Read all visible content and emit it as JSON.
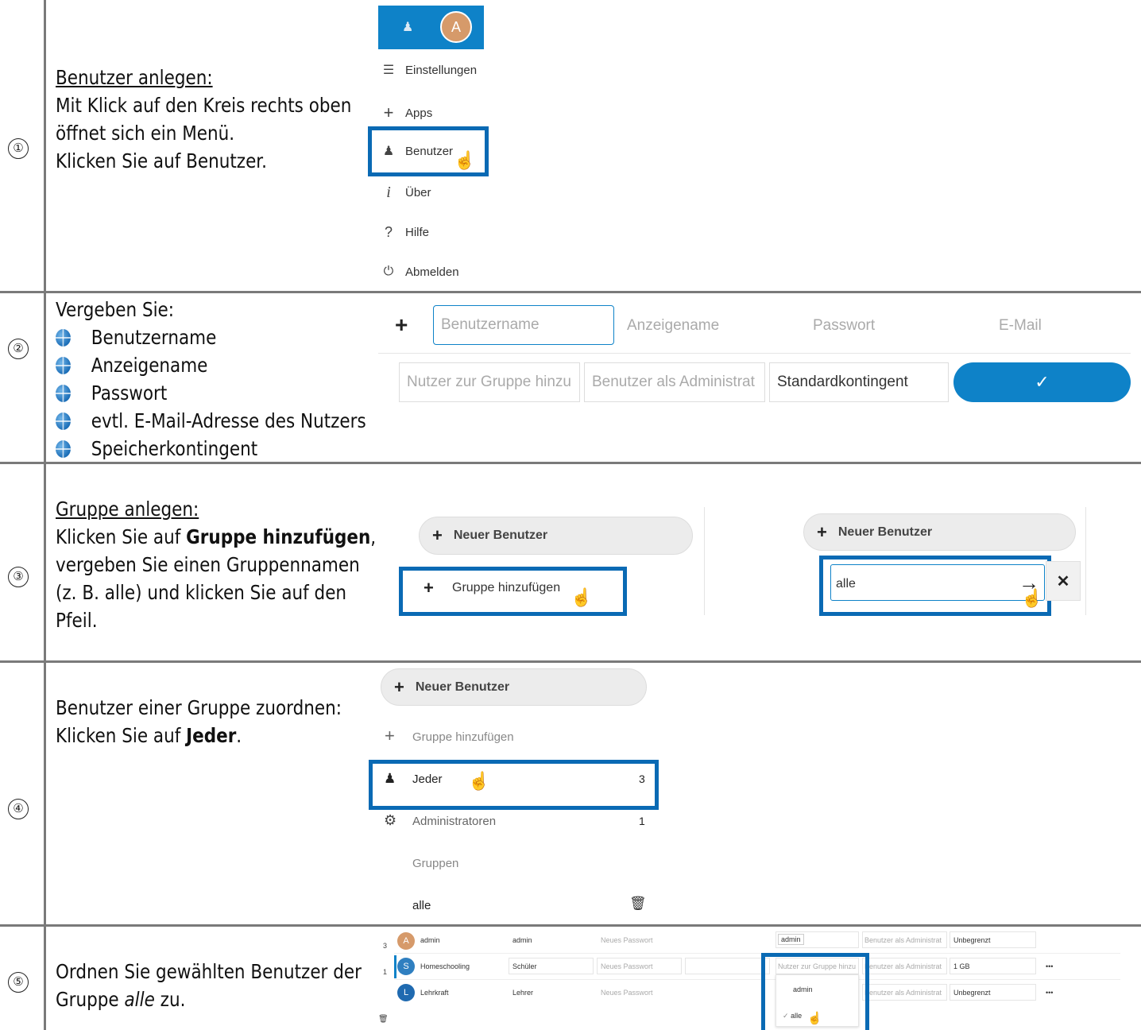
{
  "steps": [
    {
      "num": "①",
      "heading": "Benutzer anlegen:",
      "lines": [
        "Mit Klick auf den Kreis rechts oben",
        "öffnet sich ein Menü.",
        "Klicken Sie auf Benutzer."
      ]
    },
    {
      "num": "②",
      "intro": "Vergeben Sie:",
      "bullets": [
        "Benutzername",
        "Anzeigename",
        "Passwort",
        "evtl. E-Mail-Adresse des Nutzers",
        "Speicherkontingent"
      ]
    },
    {
      "num": "③",
      "heading": "Gruppe anlegen:",
      "l1_a": "Klicken Sie auf ",
      "l1_b": "Gruppe hinzufügen",
      "l1_c": ",",
      "l2": "vergeben Sie einen Gruppennamen",
      "l3": "(z. B. alle) und klicken Sie auf den",
      "l4": "Pfeil."
    },
    {
      "num": "④",
      "l1": "Benutzer einer Gruppe zuordnen:",
      "l2_a": "Klicken Sie auf ",
      "l2_b": "Jeder",
      "l2_c": "."
    },
    {
      "num": "⑤",
      "l1": "Ordnen Sie gewählten Benutzer der",
      "l2_a": "Gruppe ",
      "l2_b": "alle",
      "l2_c": " zu."
    }
  ],
  "menu": {
    "avatar_letter": "A",
    "items": [
      "Einstellungen",
      "Apps",
      "Benutzer",
      "Über",
      "Hilfe",
      "Abmelden"
    ]
  },
  "new_user_form": {
    "username_placeholder": "Benutzername",
    "displayname_placeholder": "Anzeigename",
    "password_placeholder": "Passwort",
    "email_placeholder": "E-Mail",
    "group_placeholder": "Nutzer zur Gruppe hinzu",
    "admin_placeholder": "Benutzer als Administrat",
    "quota_value": "Standardkontingent"
  },
  "group_panel": {
    "new_user": "Neuer Benutzer",
    "add_group": "Gruppe hinzufügen",
    "group_input_value": "alle"
  },
  "group_list": {
    "new_user": "Neuer Benutzer",
    "add_group": "Gruppe hinzufügen",
    "everyone": "Jeder",
    "everyone_count": "3",
    "admins": "Administratoren",
    "admins_count": "1",
    "groups_header": "Gruppen",
    "group_alle": "alle"
  },
  "user_table": {
    "side_counts": [
      "3",
      "1"
    ],
    "rows": [
      {
        "avatar": "A",
        "avatar_color": "#d69a6a",
        "name": "admin",
        "display": "admin",
        "password": "Neues Passwort",
        "group": "admin",
        "admin": "Benutzer als Administrat",
        "quota": "Unbegrenzt",
        "more": ""
      },
      {
        "avatar": "S",
        "avatar_color": "#2f7fc0",
        "name": "Homeschooling",
        "display": "Schüler",
        "password": "Neues Passwort",
        "group": "Nutzer zur Gruppe hinzu",
        "admin": "Benutzer als Administrat",
        "quota": "1 GB",
        "more": "•••"
      },
      {
        "avatar": "L",
        "avatar_color": "#1f6ab0",
        "name": "Lehrkraft",
        "display": "Lehrer",
        "password": "Neues Passwort",
        "group": "",
        "admin": "Benutzer als Administrat",
        "quota": "Unbegrenzt",
        "more": "•••"
      }
    ],
    "dropdown": [
      "admin",
      "alle"
    ]
  },
  "colors": {
    "accent": "#0a6ab4",
    "button_blue": "#0e82c8"
  }
}
